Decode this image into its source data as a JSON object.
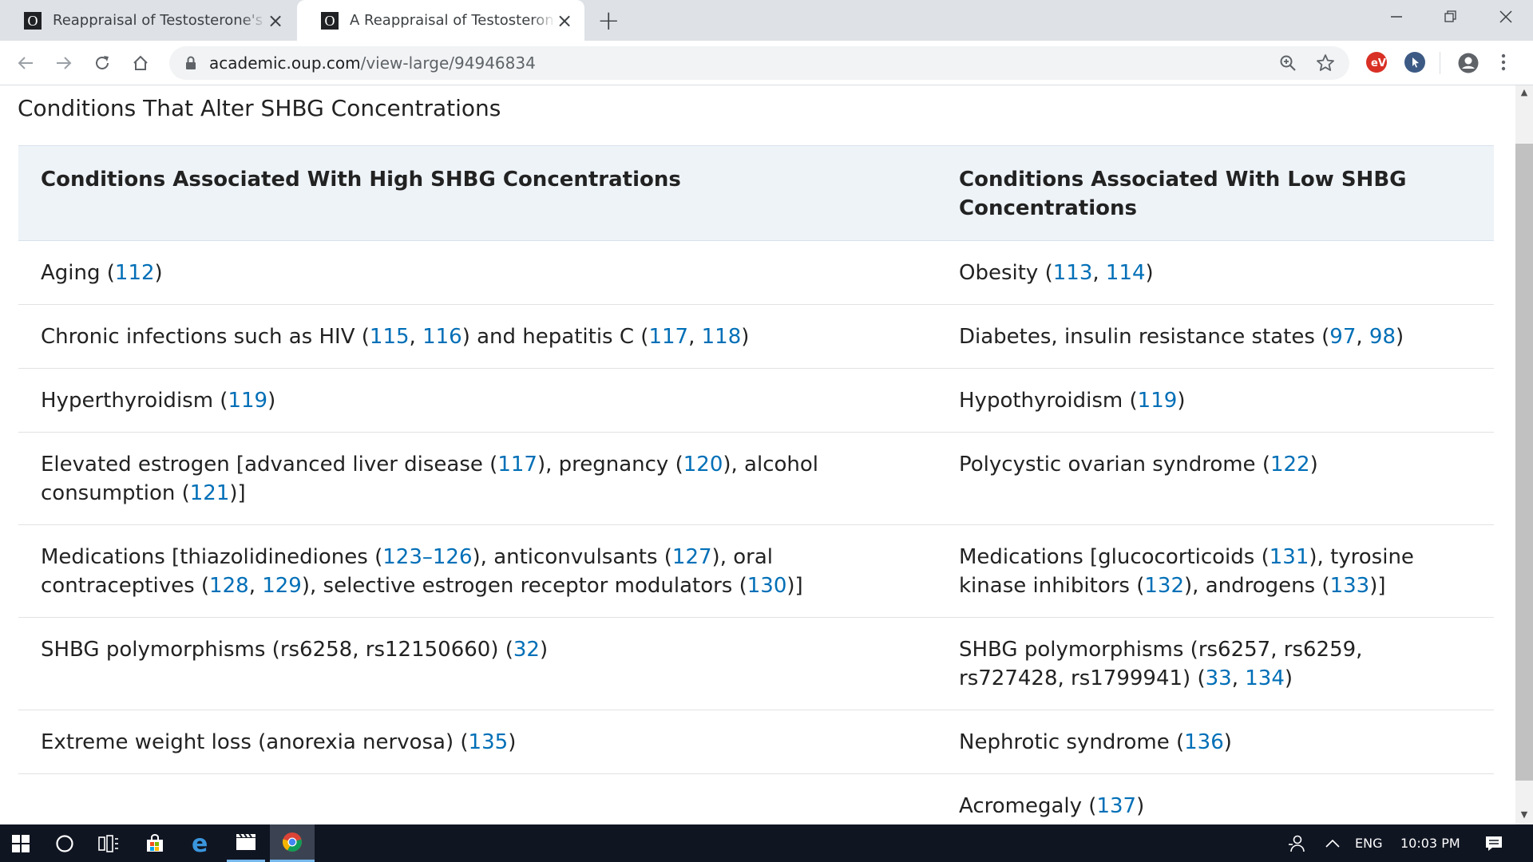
{
  "browser": {
    "tabs": [
      {
        "favicon": "O",
        "title": "Reappraisal of Testosterone's Bin",
        "active": false
      },
      {
        "favicon": "O",
        "title": "A Reappraisal of Testosterone's B",
        "active": true
      }
    ],
    "url_host": "academic.oup.com",
    "url_path": "/view-large/94946834"
  },
  "page": {
    "caption": "Conditions That Alter SHBG Concentrations",
    "headers": [
      "Conditions Associated With High SHBG Concentrations",
      "Conditions Associated With Low SHBG Concentrations"
    ],
    "rows": [
      {
        "high": [
          {
            "t": "Aging ("
          },
          {
            "r": "112"
          },
          {
            "t": ")"
          }
        ],
        "low": [
          {
            "t": "Obesity ("
          },
          {
            "r": "113"
          },
          {
            "t": ", "
          },
          {
            "r": "114"
          },
          {
            "t": ")"
          }
        ]
      },
      {
        "high": [
          {
            "t": "Chronic infections such as HIV ("
          },
          {
            "r": "115"
          },
          {
            "t": ", "
          },
          {
            "r": "116"
          },
          {
            "t": ") and hepatitis C ("
          },
          {
            "r": "117"
          },
          {
            "t": ", "
          },
          {
            "r": "118"
          },
          {
            "t": ")"
          }
        ],
        "low": [
          {
            "t": "Diabetes, insulin resistance states ("
          },
          {
            "r": "97"
          },
          {
            "t": ", "
          },
          {
            "r": "98"
          },
          {
            "t": ")"
          }
        ]
      },
      {
        "high": [
          {
            "t": "Hyperthyroidism ("
          },
          {
            "r": "119"
          },
          {
            "t": ")"
          }
        ],
        "low": [
          {
            "t": "Hypothyroidism ("
          },
          {
            "r": "119"
          },
          {
            "t": ")"
          }
        ]
      },
      {
        "high": [
          {
            "t": "Elevated estrogen [advanced liver disease ("
          },
          {
            "r": "117"
          },
          {
            "t": "), pregnancy ("
          },
          {
            "r": "120"
          },
          {
            "t": "), alcohol consumption ("
          },
          {
            "r": "121"
          },
          {
            "t": ")]"
          }
        ],
        "low": [
          {
            "t": "Polycystic ovarian syndrome ("
          },
          {
            "r": "122"
          },
          {
            "t": ")"
          }
        ]
      },
      {
        "high": [
          {
            "t": "Medications [thiazolidinediones ("
          },
          {
            "r": "123–126"
          },
          {
            "t": "), anticonvulsants ("
          },
          {
            "r": "127"
          },
          {
            "t": "), oral contraceptives ("
          },
          {
            "r": "128"
          },
          {
            "t": ", "
          },
          {
            "r": "129"
          },
          {
            "t": "), selective estrogen receptor modulators ("
          },
          {
            "r": "130"
          },
          {
            "t": ")]"
          }
        ],
        "low": [
          {
            "t": "Medications [glucocorticoids ("
          },
          {
            "r": "131"
          },
          {
            "t": "), tyrosine kinase inhibitors ("
          },
          {
            "r": "132"
          },
          {
            "t": "), androgens ("
          },
          {
            "r": "133"
          },
          {
            "t": ")]"
          }
        ]
      },
      {
        "high": [
          {
            "t": "SHBG polymorphisms (rs6258, rs12150660) ("
          },
          {
            "r": "32"
          },
          {
            "t": ")"
          }
        ],
        "low": [
          {
            "t": "SHBG polymorphisms (rs6257, rs6259, rs727428, rs1799941) ("
          },
          {
            "r": "33"
          },
          {
            "t": ", "
          },
          {
            "r": "134"
          },
          {
            "t": ")"
          }
        ]
      },
      {
        "high": [
          {
            "t": "Extreme weight loss (anorexia nervosa) ("
          },
          {
            "r": "135"
          },
          {
            "t": ")"
          }
        ],
        "low": [
          {
            "t": "Nephrotic syndrome ("
          },
          {
            "r": "136"
          },
          {
            "t": ")"
          }
        ]
      },
      {
        "high": [],
        "low": [
          {
            "t": "Acromegaly ("
          },
          {
            "r": "137"
          },
          {
            "t": ")"
          }
        ]
      }
    ],
    "link_color": "#006fb7"
  },
  "taskbar": {
    "language": "ENG",
    "time": "10:03 PM"
  }
}
